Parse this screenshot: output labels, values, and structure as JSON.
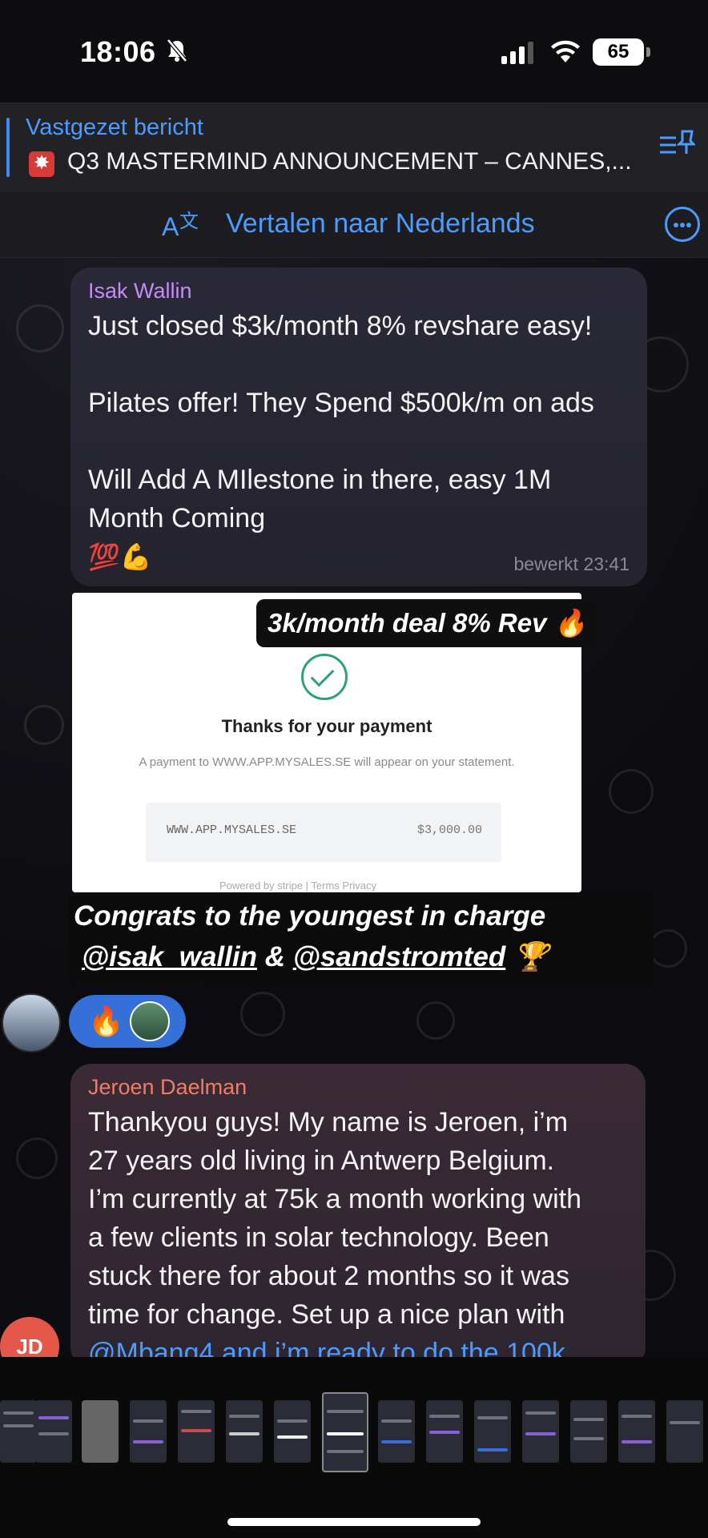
{
  "status": {
    "time": "18:06",
    "battery": "65",
    "icons": [
      "bell-slash-icon",
      "signal-icon",
      "wifi-icon",
      "battery-icon"
    ]
  },
  "pinned": {
    "title": "Vastgezet bericht",
    "text": "Q3 MASTERMIND ANNOUNCEMENT – CANNES,...",
    "icon": "pinned-list-icon"
  },
  "translate": {
    "label": "Vertalen naar Nederlands",
    "icon": "translate-icon",
    "more_icon": "more-icon"
  },
  "message1": {
    "sender": "Isak Wallin",
    "sender_color": "#c58cf5",
    "lines": [
      "Just closed $3k/month 8% revshare easy!",
      "Pilates offer! They Spend $500k/m on ads",
      "Will Add A MIlestone in there, easy 1M",
      "Month Coming"
    ],
    "emojis": "💯💪",
    "meta": "bewerkt 23:41"
  },
  "image": {
    "tag": "3k/month deal 8% Rev 🔥",
    "thanks": "Thanks for your payment",
    "note": "A payment to WWW.APP.MYSALES.SE will appear on your statement.",
    "merchant": "WWW.APP.MYSALES.SE",
    "amount": "$3,000.00",
    "footer": "Powered by stripe   |   Terms   Privacy"
  },
  "caption": {
    "line1": "Congrats to the youngest in charge",
    "user1": "@isak_wallin",
    "amp": " & ",
    "user2": "@sandstromted",
    "trophy": "🏆"
  },
  "reaction": {
    "emoji": "🔥"
  },
  "message2": {
    "sender": "Jeroen Daelman",
    "sender_color": "#f07c6a",
    "lines": [
      "Thankyou guys! My name is Jeroen, i’m",
      "27 years old living in Antwerp Belgium.",
      "I’m currently at 75k a month working with",
      "a few clients in solar technology. Been",
      "stuck there for about 2 months so it was",
      "time for change. Set up a nice plan with",
      "@Mbang4 and i’m ready to do the 100k"
    ],
    "avatar_initials": "JD"
  }
}
